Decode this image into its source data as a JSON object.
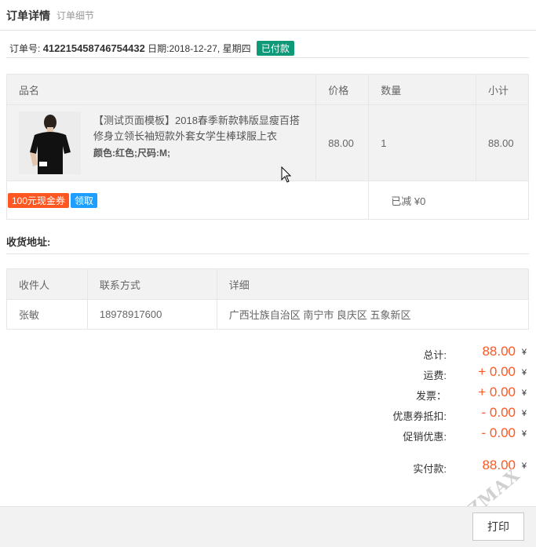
{
  "header": {
    "title": "订单详情",
    "subtitle": "订单细节"
  },
  "order": {
    "number_label": "订单号:",
    "number": "412215458746754432",
    "date_label": "日期:",
    "date": "2018-12-27, 星期四",
    "status_badge": "已付款"
  },
  "product_table": {
    "columns": [
      "品名",
      "价格",
      "数量",
      "小计"
    ],
    "rows": [
      {
        "name": "【测试页面模板】2018春季新款韩版显瘦百搭修身立领长袖短款外套女学生棒球服上衣",
        "attributes": "颜色:红色;尺码:M;",
        "price": "88.00",
        "quantity": "1",
        "subtotal": "88.00"
      }
    ],
    "coupon_label": "100元现金券",
    "claim_label": "领取",
    "discount_text": "已减 ¥0"
  },
  "address": {
    "section_title": "收货地址:",
    "columns": [
      "收件人",
      "联系方式",
      "详细"
    ],
    "rows": [
      {
        "recipient": "张敏",
        "phone": "18978917600",
        "detail": "广西壮族自治区 南宁市 良庆区 五象新区"
      }
    ]
  },
  "summary": [
    {
      "label": "总计:",
      "value": "88.00"
    },
    {
      "label": "运费:",
      "value": "+ 0.00"
    },
    {
      "label": "发票：",
      "value": "+ 0.00"
    },
    {
      "label": "优惠券抵扣:",
      "value": "- 0.00"
    },
    {
      "label": "促销优惠:",
      "value": "- 0.00"
    }
  ],
  "paid": {
    "label": "实付款:",
    "value": "88.00"
  },
  "currency_symbol": "¥",
  "footer": {
    "print_label": "打印"
  },
  "watermark": "ZMAX",
  "colors": {
    "accent": "#ff5722",
    "paid_badge": "#0e9a78",
    "claim": "#1e9fff"
  }
}
